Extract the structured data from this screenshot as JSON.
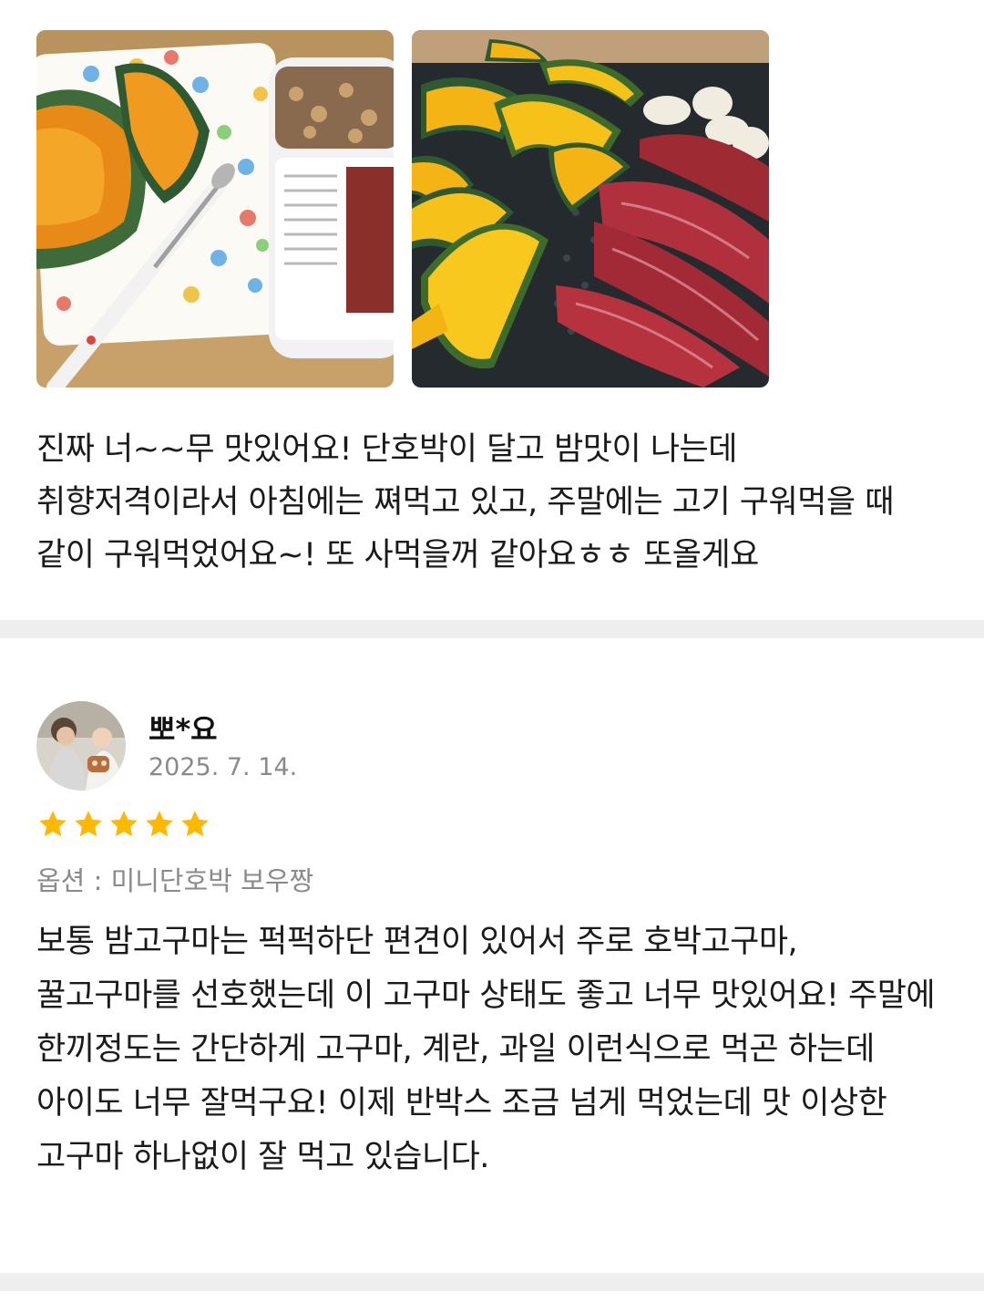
{
  "review_1": {
    "photos": [
      {
        "name": "kabocha-and-cereal-photo"
      },
      {
        "name": "grill-pumpkin-beef-photo"
      }
    ],
    "body": "진짜 너~~무 맛있어요! 단호박이 달고 밤맛이 나는데 취향저격이라서 아침에는 쪄먹고 있고, 주말에는 고기 구워먹을 때 같이 구워먹었어요~! 또 사먹을꺼 같아요ㅎㅎ 또올게요"
  },
  "review_2": {
    "author": "뽀*요",
    "date": "2025. 7. 14.",
    "rating": 5,
    "option_label": "옵션 : 미니단호박 보우짱",
    "body": "보통 밤고구마는 퍽퍽하단 편견이 있어서 주로 호박고구마, 꿀고구마를 선호했는데 이 고구마 상태도 좋고 너무 맛있어요! 주말에 한끼정도는 간단하게 고구마, 계란, 과일 이런식으로 먹곤 하는데 아이도 너무 잘먹구요! 이제 반박스 조금 넘게 먹었는데 맛 이상한 고구마 하나없이 잘 먹고 있습니다."
  },
  "colors": {
    "star": "#FFB800",
    "divider": "#EEEEEE",
    "meta_text": "#8A8A8A",
    "body_text": "#1A1A1A"
  },
  "icons": {
    "rating": "star-icon"
  }
}
